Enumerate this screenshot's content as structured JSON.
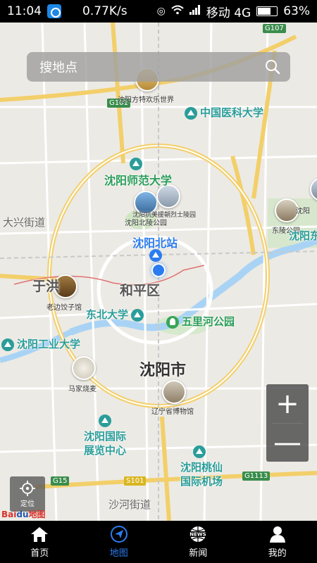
{
  "status_bar": {
    "time": "11:04",
    "speed": "0.77K/s",
    "carrier": "移动 4G",
    "battery": "63%"
  },
  "search": {
    "placeholder": "搜地点"
  },
  "map": {
    "roads": [
      "G101",
      "G107",
      "G15",
      "S101",
      "G1113"
    ],
    "places": [
      {
        "name": "沈阳方特欢乐世界",
        "type": "photo"
      },
      {
        "name": "中国医科大学",
        "type": "university"
      },
      {
        "name": "沈阳师范大学",
        "type": "university"
      },
      {
        "name": "沈阳北陵公园",
        "type": "photo"
      },
      {
        "name": "沈阳抗美援朝烈士陵园",
        "type": "photo"
      },
      {
        "name": "东陵公园",
        "type": "photo"
      },
      {
        "name": "沈阳北站",
        "type": "station"
      },
      {
        "name": "和平区",
        "type": "district"
      },
      {
        "name": "老边饺子馆",
        "type": "photo"
      },
      {
        "name": "东北大学",
        "type": "university"
      },
      {
        "name": "五里河公园",
        "type": "park"
      },
      {
        "name": "沈阳工业大学",
        "type": "university"
      },
      {
        "name": "沈阳市",
        "type": "city"
      },
      {
        "name": "马家烧麦",
        "type": "photo"
      },
      {
        "name": "辽宁省博物馆",
        "type": "photo"
      },
      {
        "name": "沈阳国际展览中心",
        "type": "venue"
      },
      {
        "name": "沈阳桃仙国际机场",
        "type": "airport"
      },
      {
        "name": "大兴街道",
        "type": "area"
      },
      {
        "name": "于洪",
        "type": "area"
      },
      {
        "name": "沙河街道",
        "type": "area"
      },
      {
        "name": "沈阳东",
        "type": "area"
      },
      {
        "name": "沈阳",
        "type": "area"
      }
    ]
  },
  "zoom": {
    "in_label": "+",
    "out_label": "—"
  },
  "locate": {
    "label": "定位"
  },
  "brand": {
    "a": "Bai",
    "b": "du",
    "c": "地图"
  },
  "tabs": [
    {
      "label": "首页",
      "icon": "home-icon",
      "active": false
    },
    {
      "label": "地图",
      "icon": "compass-icon",
      "active": true
    },
    {
      "label": "新闻",
      "icon": "news-icon",
      "active": false
    },
    {
      "label": "我的",
      "icon": "user-icon",
      "active": false
    }
  ],
  "colors": {
    "accent": "#2b7cf0",
    "bar_bg": "#000000",
    "map_bg": "#eceae4",
    "road": "#ffffff",
    "highway": "#f3cf6a",
    "water": "#a9d3f5",
    "green": "#3aa55a"
  }
}
